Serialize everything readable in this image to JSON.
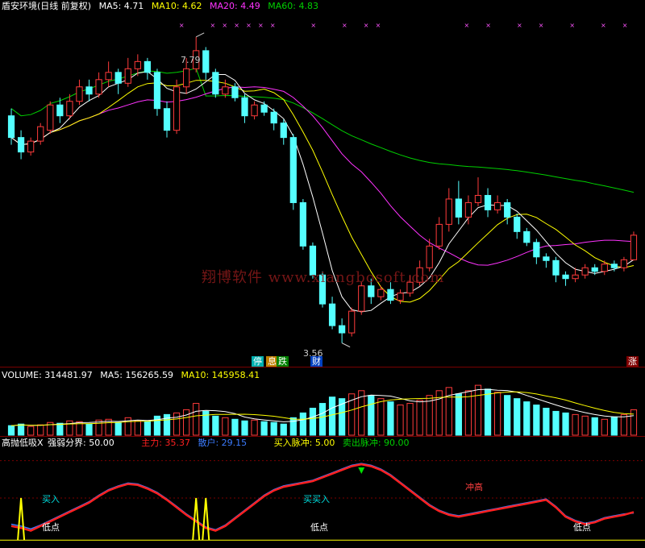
{
  "colors": {
    "up": "#ff3b3b",
    "down": "#54ffff",
    "ma5": "#ffffff",
    "ma10": "#ffff00",
    "ma20": "#ff33ff",
    "ma60": "#00d000",
    "vol_ma5": "#ffffff",
    "vol_ma10": "#ffff00",
    "main": "#ff2020",
    "retail": "#3b7bff",
    "signal": "#ffff00",
    "grid": "#7a0000"
  },
  "header": {
    "title": "盾安环境(日线 前复权)",
    "ma5": "MA5: 4.71",
    "ma10": "MA10: 4.62",
    "ma20": "MA20: 4.49",
    "ma60": "MA60: 4.83"
  },
  "volume_header": {
    "vol": "VOLUME: 314481.97",
    "ma5": "MA5: 156265.59",
    "ma10": "MA10: 145958.41"
  },
  "indicator_header": {
    "name": "高抛低吸X",
    "strength": "强弱分界: 50.00",
    "main": "主力: 35.37",
    "retail": "散户: 29.15",
    "buy_pulse": "买入脉冲: 5.00",
    "sell_pulse": "卖出脉冲: 90.00"
  },
  "annotations": {
    "high": "7.79",
    "low": "3.56",
    "tag_ting": "停",
    "tag_fuxi": "息",
    "tag_die": "跌",
    "tag_cai": "财",
    "tag_zhang": "涨",
    "buy": "买入",
    "buy2": "买买入",
    "low_point": "低点",
    "chong_gao": "冲高"
  },
  "watermark": "翔博软件  www.xiangbosoft.com",
  "chart_data": [
    {
      "type": "candlestick",
      "title": "盾安环境(日线 前复权)",
      "price_range": [
        3.4,
        8.1
      ],
      "high": 7.79,
      "low": 3.56,
      "candles": [
        [
          6.7,
          6.4,
          6.8,
          6.3
        ],
        [
          6.4,
          6.2,
          6.5,
          6.1
        ],
        [
          6.2,
          6.35,
          6.4,
          6.15
        ],
        [
          6.35,
          6.55,
          6.6,
          6.3
        ],
        [
          6.5,
          6.85,
          6.9,
          6.45
        ],
        [
          6.85,
          6.7,
          6.95,
          6.6
        ],
        [
          6.7,
          6.9,
          7.0,
          6.65
        ],
        [
          6.9,
          7.1,
          7.2,
          6.85
        ],
        [
          7.1,
          7.0,
          7.2,
          6.9
        ],
        [
          7.0,
          7.2,
          7.3,
          6.95
        ],
        [
          7.2,
          7.3,
          7.45,
          7.1
        ],
        [
          7.3,
          7.15,
          7.35,
          7.0
        ],
        [
          7.15,
          7.35,
          7.5,
          7.1
        ],
        [
          7.35,
          7.45,
          7.55,
          7.25
        ],
        [
          7.45,
          7.3,
          7.5,
          7.2
        ],
        [
          7.3,
          6.8,
          7.35,
          6.7
        ],
        [
          6.8,
          6.5,
          6.9,
          6.4
        ],
        [
          6.5,
          7.1,
          7.2,
          6.45
        ],
        [
          7.1,
          7.35,
          7.5,
          7.0
        ],
        [
          7.35,
          7.6,
          7.79,
          7.3
        ],
        [
          7.6,
          7.3,
          7.65,
          7.2
        ],
        [
          7.3,
          7.0,
          7.35,
          6.95
        ],
        [
          7.0,
          7.1,
          7.2,
          6.95
        ],
        [
          7.1,
          6.95,
          7.15,
          6.9
        ],
        [
          6.95,
          6.7,
          7.0,
          6.6
        ],
        [
          6.7,
          6.85,
          6.9,
          6.65
        ],
        [
          6.85,
          6.75,
          6.9,
          6.7
        ],
        [
          6.75,
          6.6,
          6.8,
          6.5
        ],
        [
          6.6,
          6.4,
          6.65,
          6.3
        ],
        [
          6.4,
          5.5,
          6.45,
          5.4
        ],
        [
          5.5,
          4.9,
          5.55,
          4.85
        ],
        [
          4.9,
          4.5,
          4.95,
          4.45
        ],
        [
          4.5,
          4.1,
          4.55,
          4.05
        ],
        [
          4.1,
          3.8,
          4.2,
          3.75
        ],
        [
          3.8,
          3.7,
          3.9,
          3.56
        ],
        [
          3.7,
          4.0,
          4.05,
          3.65
        ],
        [
          4.0,
          4.35,
          4.4,
          3.95
        ],
        [
          4.35,
          4.2,
          4.45,
          4.1
        ],
        [
          4.2,
          4.3,
          4.35,
          4.15
        ],
        [
          4.3,
          4.15,
          4.4,
          4.1
        ],
        [
          4.15,
          4.25,
          4.3,
          4.1
        ],
        [
          4.25,
          4.4,
          4.5,
          4.2
        ],
        [
          4.4,
          4.6,
          4.7,
          4.35
        ],
        [
          4.6,
          4.9,
          5.0,
          4.55
        ],
        [
          4.9,
          5.2,
          5.3,
          4.85
        ],
        [
          5.2,
          5.55,
          5.7,
          5.1
        ],
        [
          5.55,
          5.3,
          5.8,
          5.2
        ],
        [
          5.3,
          5.5,
          5.6,
          5.2
        ],
        [
          5.5,
          5.6,
          5.85,
          5.45
        ],
        [
          5.6,
          5.4,
          5.7,
          5.3
        ],
        [
          5.4,
          5.5,
          5.6,
          5.35
        ],
        [
          5.5,
          5.3,
          5.55,
          5.2
        ],
        [
          5.3,
          5.1,
          5.35,
          5.0
        ],
        [
          5.1,
          4.95,
          5.15,
          4.9
        ],
        [
          4.95,
          4.75,
          5.0,
          4.65
        ],
        [
          4.75,
          4.7,
          4.8,
          4.6
        ],
        [
          4.7,
          4.5,
          4.75,
          4.4
        ],
        [
          4.5,
          4.45,
          4.55,
          4.35
        ],
        [
          4.45,
          4.5,
          4.6,
          4.4
        ],
        [
          4.5,
          4.6,
          4.65,
          4.45
        ],
        [
          4.6,
          4.55,
          4.65,
          4.5
        ],
        [
          4.55,
          4.65,
          4.7,
          4.5
        ],
        [
          4.65,
          4.6,
          4.7,
          4.55
        ],
        [
          4.6,
          4.71,
          4.75,
          4.55
        ],
        [
          4.71,
          5.05,
          5.1,
          4.7
        ]
      ]
    },
    {
      "type": "bar",
      "title": "VOLUME",
      "values": [
        60,
        70,
        55,
        65,
        80,
        75,
        90,
        85,
        70,
        95,
        100,
        80,
        110,
        90,
        85,
        120,
        130,
        140,
        160,
        200,
        150,
        120,
        110,
        100,
        90,
        95,
        85,
        80,
        70,
        110,
        140,
        170,
        200,
        240,
        230,
        260,
        280,
        250,
        230,
        210,
        190,
        200,
        220,
        250,
        280,
        300,
        260,
        280,
        314,
        290,
        270,
        250,
        230,
        210,
        190,
        170,
        150,
        140,
        130,
        120,
        110,
        100,
        115,
        130,
        160
      ],
      "ma5": 156265.59,
      "ma10": 145958.41
    },
    {
      "type": "line",
      "title": "高抛低吸X",
      "series": [
        {
          "name": "主力",
          "values": [
            20,
            18,
            15,
            20,
            25,
            30,
            35,
            40,
            45,
            52,
            58,
            62,
            65,
            64,
            60,
            55,
            48,
            40,
            32,
            25,
            18,
            15,
            20,
            28,
            36,
            44,
            52,
            58,
            62,
            64,
            66,
            68,
            72,
            76,
            80,
            84,
            86,
            84,
            80,
            74,
            66,
            58,
            50,
            42,
            36,
            32,
            30,
            32,
            34,
            36,
            38,
            40,
            42,
            44,
            46,
            48,
            40,
            30,
            25,
            22,
            24,
            28,
            30,
            32,
            35
          ]
        },
        {
          "name": "散户",
          "values": [
            22,
            20,
            17,
            21,
            26,
            31,
            36,
            41,
            46,
            53,
            59,
            63,
            66,
            65,
            61,
            56,
            49,
            41,
            33,
            26,
            19,
            16,
            21,
            29,
            37,
            45,
            53,
            59,
            63,
            65,
            67,
            69,
            73,
            77,
            81,
            85,
            87,
            85,
            81,
            75,
            67,
            59,
            51,
            43,
            37,
            33,
            31,
            33,
            35,
            37,
            39,
            41,
            43,
            45,
            47,
            49,
            41,
            31,
            26,
            23,
            25,
            29,
            31,
            33,
            34
          ]
        }
      ],
      "levels": {
        "强弱分界": 50.0,
        "买入脉冲": 5.0,
        "卖出脉冲": 90.0
      }
    }
  ]
}
